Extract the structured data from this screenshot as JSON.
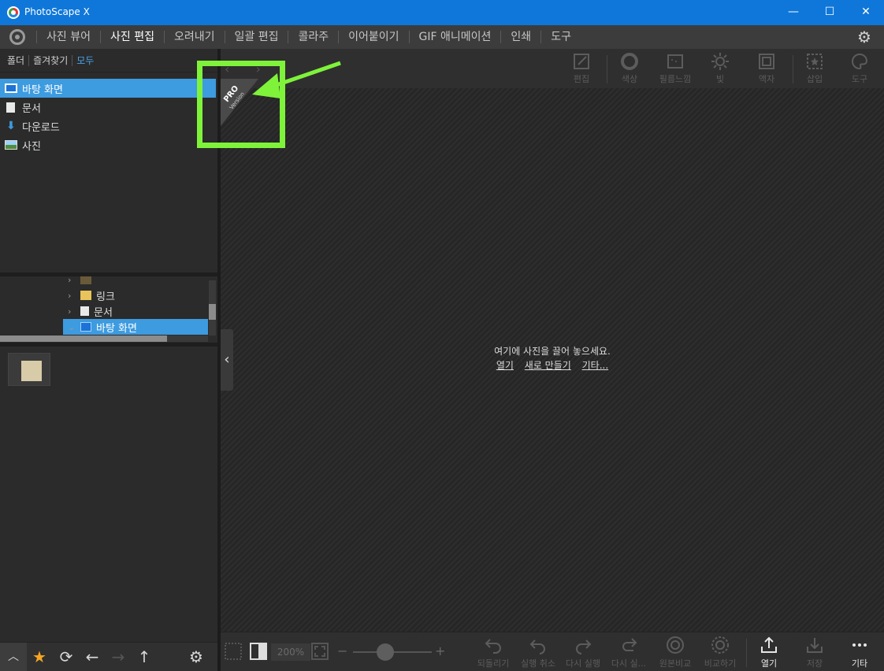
{
  "window": {
    "title": "PhotoScape X",
    "minimize": "—",
    "maximize": "☐",
    "close": "✕"
  },
  "menu": {
    "items": [
      "사진 뷰어",
      "사진 편집",
      "오려내기",
      "일괄 편집",
      "콜라주",
      "이어붙이기",
      "GIF 애니메이션",
      "인쇄",
      "도구"
    ],
    "active": "사진 편집"
  },
  "left": {
    "tabs": [
      "폴더",
      "즐겨찾기",
      "모두"
    ],
    "active_tab": "모두",
    "places": [
      "바탕 화면",
      "문서",
      "다운로드",
      "사진"
    ],
    "selected_place": "바탕 화면",
    "tree": [
      "링크",
      "문서",
      "바탕 화면"
    ],
    "tree_selected": "바탕 화면"
  },
  "toolbar_top": [
    "편집",
    "색상",
    "필름느낌",
    "빛",
    "액자",
    "삽입",
    "도구"
  ],
  "canvas": {
    "message": "여기에 사진을 끌어 놓으세요.",
    "links": [
      "열기",
      "새로 만들기",
      "기타..."
    ]
  },
  "pro_badge": {
    "pro": "PRO",
    "version": "Version"
  },
  "toolbar_bottom": {
    "zoom": "200%",
    "buttons": [
      "되돌리기",
      "실행 취소",
      "다시 실행",
      "다시 실...",
      "원본비교",
      "비교하기",
      "열기",
      "저장",
      "기타"
    ]
  },
  "colors": {
    "titlebar": "#0f77d9",
    "accent": "#3d9be0",
    "highlight": "#7ef33a"
  },
  "icons": {
    "menu_logo": "photoscape-logo-icon",
    "settings": "gear-icon",
    "left_bottom": [
      "chevron-up-icon",
      "star-icon",
      "refresh-icon",
      "arrow-left-icon",
      "arrow-right-icon",
      "arrow-up-icon",
      "gear-icon"
    ]
  }
}
